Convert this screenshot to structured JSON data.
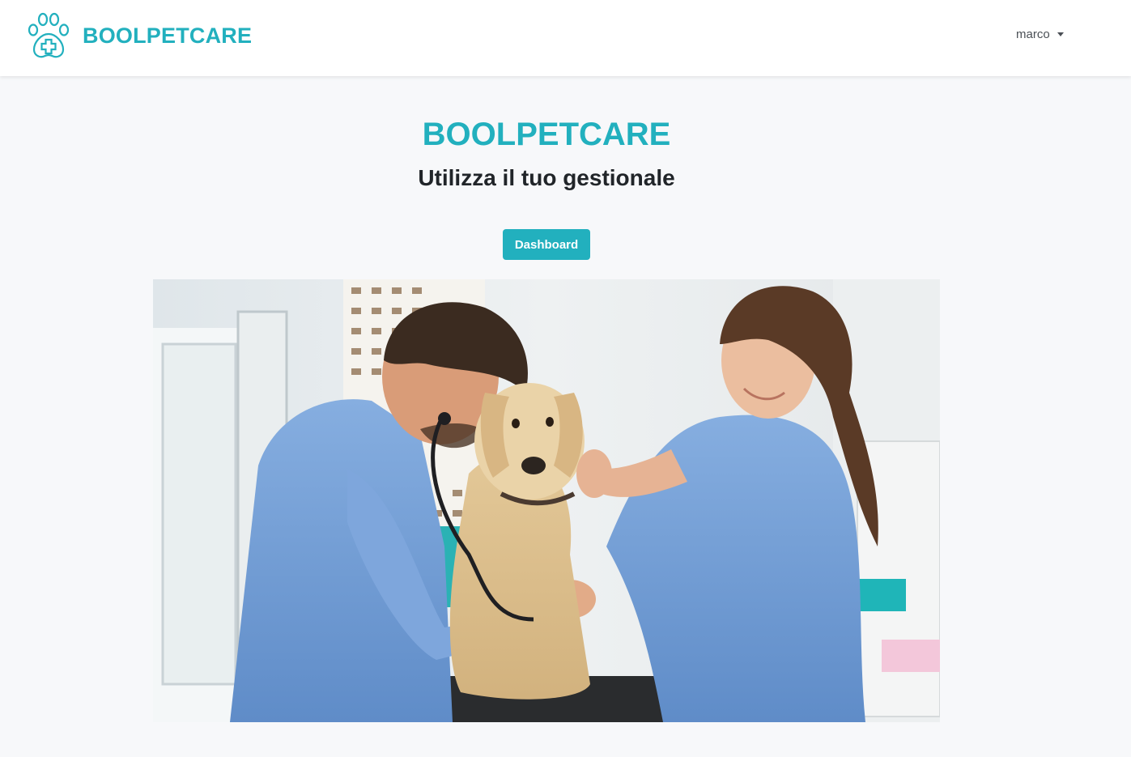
{
  "navbar": {
    "brand_name": "BOOLPETCARE",
    "logo_icon": "paw-medical-cross-icon",
    "user_menu_label": "marco",
    "user_menu_icon": "caret-down-icon"
  },
  "hero": {
    "title": "BOOLPETCARE",
    "subtitle": "Utilizza il tuo gestionale",
    "dashboard_button_label": "Dashboard"
  },
  "colors": {
    "accent": "#22b0be",
    "page_background": "#f7f8fa",
    "navbar_background": "#ffffff",
    "text_dark": "#212529"
  }
}
